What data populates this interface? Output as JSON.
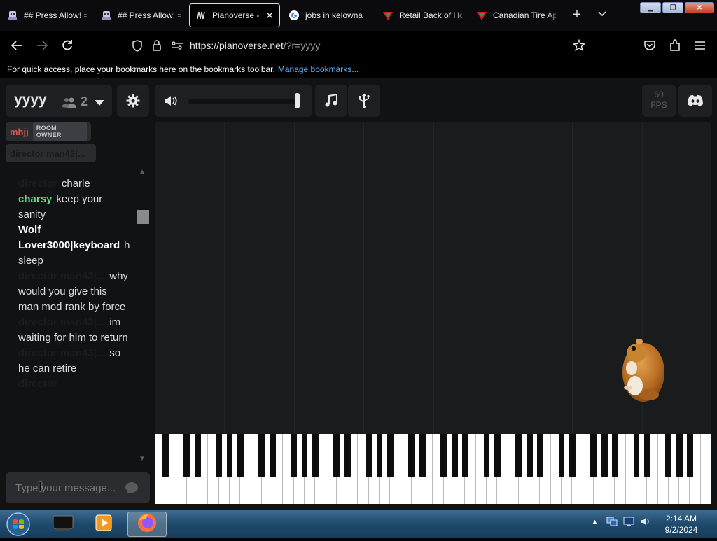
{
  "browser": {
    "tabs": [
      {
        "title": "## Press Allow! =",
        "icon": "extension-avatar-icon",
        "active": false
      },
      {
        "title": "## Press Allow! =",
        "icon": "extension-avatar-icon",
        "active": false
      },
      {
        "title": "Pianoverse - y",
        "icon": "pianoverse-icon",
        "active": true
      },
      {
        "title": "jobs in kelowna",
        "icon": "google-icon",
        "active": false
      },
      {
        "title": "Retail Back of Ho",
        "icon": "canadian-tire-icon",
        "active": false
      },
      {
        "title": "Canadian Tire Ap",
        "icon": "canadian-tire-icon",
        "active": false
      }
    ],
    "url_host": "https://pianoverse.net",
    "url_path": "/?r=yyyy",
    "bookmarks_hint": "For quick access, place your bookmarks here on the bookmarks toolbar.",
    "bookmarks_link": "Manage bookmarks..."
  },
  "room": {
    "name": "yyyy",
    "user_count": "2",
    "fps_value": "60",
    "fps_label": "FPS",
    "volume_level": 0.95
  },
  "users": {
    "owner_name": "mhjj",
    "owner_badge": "ROOM OWNER",
    "second_user": "director man43|..."
  },
  "chat": {
    "messages": [
      {
        "who": "director",
        "style": "dark",
        "text": "charle"
      },
      {
        "who": "charsy",
        "style": "green",
        "text": "keep your sanity"
      },
      {
        "who": "Wolf Lover3000|keyboard",
        "style": "white",
        "text": "he's sleep"
      },
      {
        "who": "director man43|...",
        "style": "dark",
        "text": "why would you give this man mod rank by force"
      },
      {
        "who": "director man43|...",
        "style": "dark",
        "text": "im waiting for him to return"
      },
      {
        "who": "director man43|...",
        "style": "dark",
        "text": "so he can retire"
      },
      {
        "who": "director",
        "style": "dark",
        "text": ""
      }
    ],
    "input_placeholder": "Type your message..."
  },
  "taskbar": {
    "time": "2:14 AM",
    "date": "9/2/2024"
  },
  "colors": {
    "owner_name": "#e0524a",
    "green_user": "#5ed98a",
    "link": "#5fb3ff"
  }
}
